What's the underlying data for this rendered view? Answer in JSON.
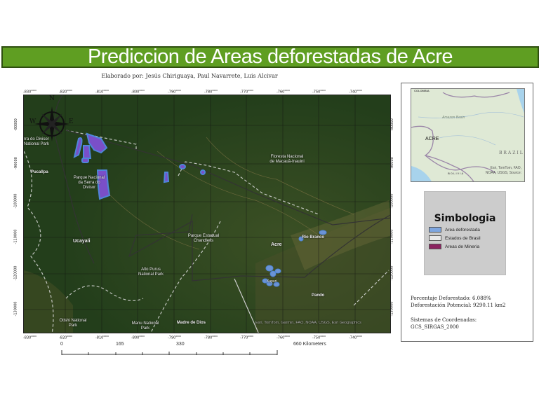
{
  "title": "Prediccion de Areas deforestadas de Acre",
  "authors": "Elaborado por: Jesús Chiriguaya, Paul Navarrete, Luis Alcivar",
  "axes": {
    "x_ticks": [
      "-830",
      "-820",
      "-810",
      "-800",
      "-790",
      "-780",
      "-770",
      "-760",
      "-750",
      "-740"
    ],
    "x_suffix": "0000",
    "y_ticks": [
      "-80000",
      "-90000",
      "-100000",
      "-110000",
      "-120000",
      "-130000"
    ]
  },
  "compass": {
    "n": "N",
    "w": "W",
    "e": "E"
  },
  "map_labels": {
    "np_divisor": "rra do Divisor National Park",
    "pucallpa": "Pucallpa",
    "serra_divisor": "Parque Nacional da Serra do Divisor",
    "floresta": "Floresta Nacional de Macauã-Inauini",
    "ucayali": "Ucayali",
    "chandless": "Parque Estadual Chandless",
    "acre": "Acre",
    "rio_branco": "Rio Branco",
    "alto_purus": "Alto Purus National Park",
    "pando": "Pando",
    "otishi": "Otishi National Park",
    "manu": "Manu National Park",
    "madre_dios": "Madre de Dios",
    "xapuri": "Xapuri",
    "attribution": "Esri, TomTom, Garmin, FAO, NOAA, USGS, Esri Geographics"
  },
  "inset": {
    "colombia": "COLOMBIA",
    "amazon": "Amazon Basin",
    "acre": "ACRE",
    "brazil": "BRAZIL",
    "bolivia": "BOLIVIA",
    "attribution": "Esri, TomTom, FAO, NOAA, USGS, Source:"
  },
  "legend": {
    "title": "Simbologia",
    "items": [
      {
        "label": "Area deforestada",
        "color": "#7ea6e0"
      },
      {
        "label": "Estados de Brasil",
        "color": "#e8e8e8"
      },
      {
        "label": "Areas de Mineria",
        "color": "#8b2260"
      }
    ]
  },
  "stats": {
    "pct": "Porcentaje Deforestado: 6.088%",
    "potential": "Deforestación Potencial: 9290.11 km2",
    "crs_label": "Sistemas de Coordenadas:",
    "crs": "GCS_SIRGAS_2000"
  },
  "scalebar": {
    "labels": [
      "0",
      "165",
      "330",
      "660 Kilometers"
    ]
  }
}
